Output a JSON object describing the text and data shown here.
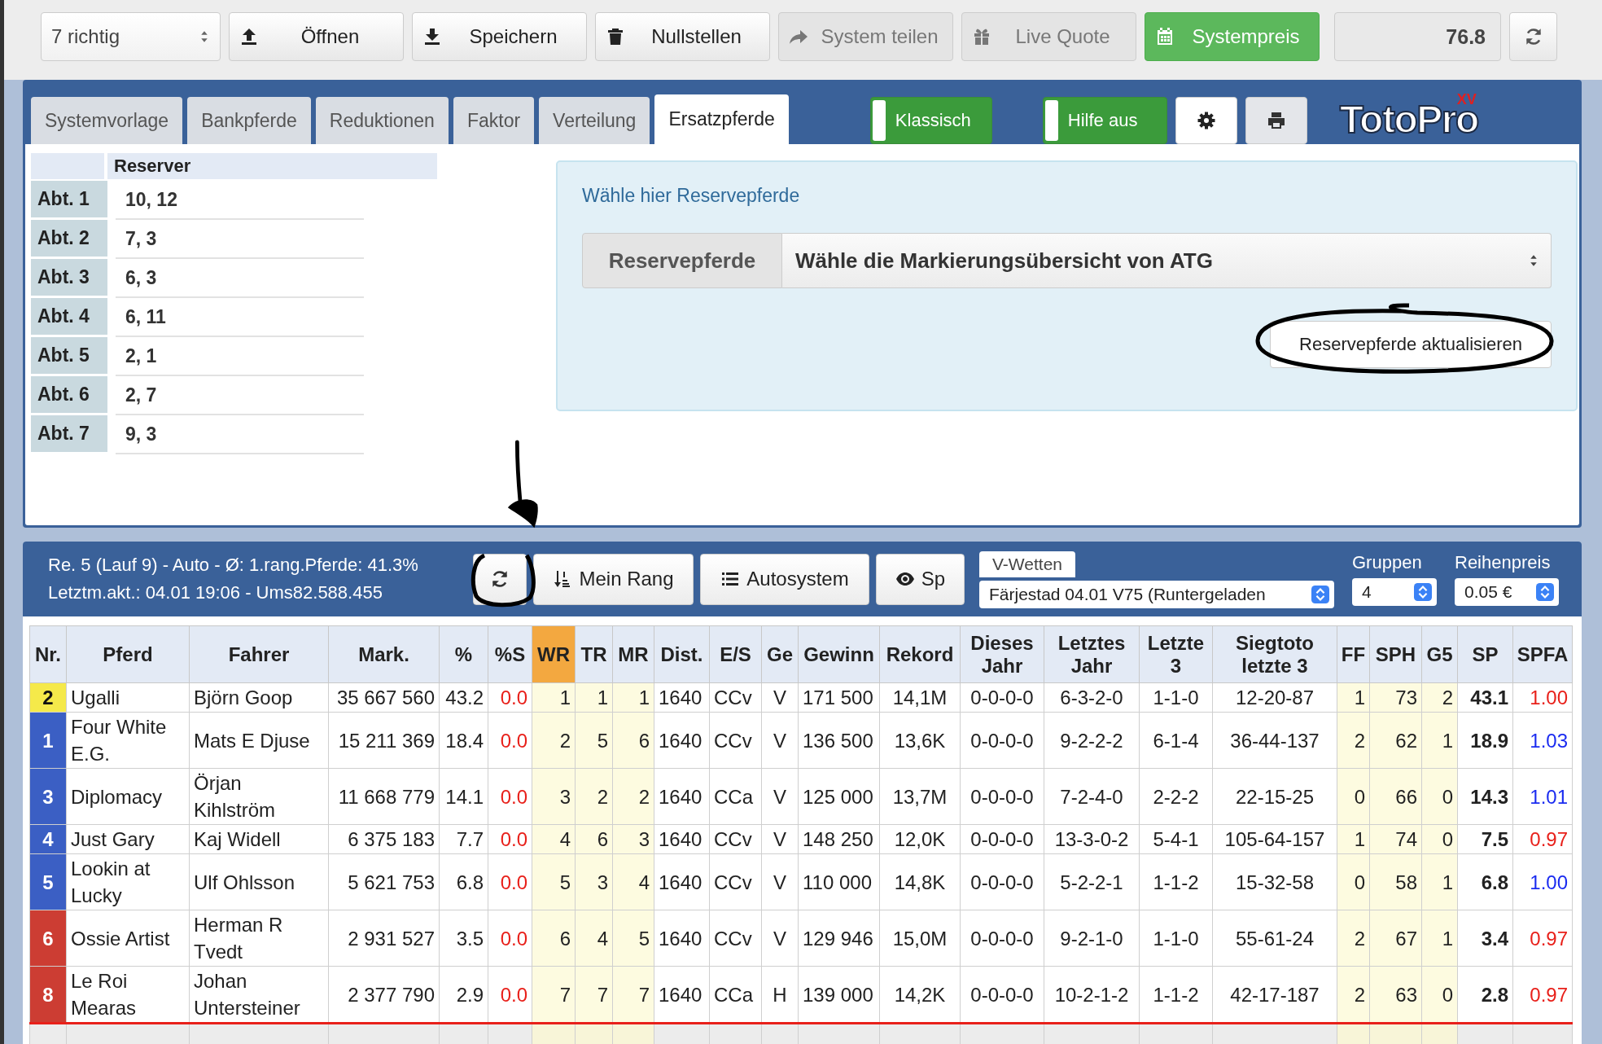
{
  "top_bar": {
    "select": {
      "value": "7 richtig"
    },
    "buttons": [
      {
        "label": "Öffnen",
        "kind": "default",
        "disabled": false
      },
      {
        "label": "Speichern",
        "kind": "default",
        "disabled": false
      },
      {
        "label": "Nullstellen",
        "kind": "default",
        "disabled": false
      },
      {
        "label": "System teilen",
        "kind": "default",
        "disabled": true
      },
      {
        "label": "Live Quote",
        "kind": "default",
        "disabled": true
      },
      {
        "label": "Systempreis",
        "kind": "success",
        "disabled": false
      }
    ],
    "price": {
      "value": "76.8"
    }
  },
  "tabs": [
    {
      "label": "Systemvorlage",
      "selected": false
    },
    {
      "label": "Bankpferde",
      "selected": false
    },
    {
      "label": "Reduktionen",
      "selected": false
    },
    {
      "label": "Faktor",
      "selected": false
    },
    {
      "label": "Verteilung",
      "selected": false
    },
    {
      "label": "Ersatzpferde",
      "selected": true
    }
  ],
  "toggles": [
    {
      "label": "Klassisch",
      "on": true
    },
    {
      "label": "Hilfe aus",
      "on": true
    }
  ],
  "logo": {
    "text": "TotoPro",
    "badge": "XV"
  },
  "reserve_table": {
    "heading": "Reserver",
    "rows": [
      {
        "label": "Abt. 1",
        "value": "10, 12"
      },
      {
        "label": "Abt. 2",
        "value": "7, 3"
      },
      {
        "label": "Abt. 3",
        "value": "6, 3"
      },
      {
        "label": "Abt. 4",
        "value": "6, 11"
      },
      {
        "label": "Abt. 5",
        "value": "2, 1"
      },
      {
        "label": "Abt. 6",
        "value": "2, 7"
      },
      {
        "label": "Abt. 7",
        "value": "9, 3"
      }
    ]
  },
  "reserve_panel": {
    "hint": "Wähle hier Reservepferde",
    "addon": "Reservepferde",
    "select": "Wähle die Markierungsübersicht von ATG",
    "button": "Reservepferde aktualisieren"
  },
  "race_bar": {
    "info": [
      "Re. 5 (Lauf 9) - Auto - Ø: 1.rang.Pferde: 41.3%",
      "Letztm.akt.: 04.01 19:06 - Ums82.588.455"
    ],
    "buttons": [
      "Mein Rang",
      "Autosystem",
      "Sp"
    ],
    "game_tab": "V-Wetten",
    "game_select": "Färjestad 04.01 V75 (Runtergeladen",
    "groups_label": "Gruppen",
    "groups": "4",
    "price_label": "Reihenpreis",
    "price": "0.05 €"
  },
  "table": {
    "columns": [
      {
        "label": "Nr.",
        "sorted": false,
        "marked": false
      },
      {
        "label": "Pferd",
        "sorted": false,
        "marked": false
      },
      {
        "label": "Fahrer",
        "sorted": false,
        "marked": false
      },
      {
        "label": "Mark.",
        "sorted": false,
        "marked": false
      },
      {
        "label": "%",
        "sorted": false,
        "marked": false
      },
      {
        "label": "%S",
        "sorted": false,
        "marked": false
      },
      {
        "label": "WR",
        "sorted": true,
        "marked": true
      },
      {
        "label": "TR",
        "sorted": false,
        "marked": true
      },
      {
        "label": "MR",
        "sorted": false,
        "marked": true
      },
      {
        "label": "Dist.",
        "sorted": false,
        "marked": false
      },
      {
        "label": "E/S",
        "sorted": false,
        "marked": false
      },
      {
        "label": "Ge",
        "sorted": false,
        "marked": false
      },
      {
        "label": "Gewinn",
        "sorted": false,
        "marked": false
      },
      {
        "label": "Rekord",
        "sorted": false,
        "marked": false
      },
      {
        "label": "Dieses Jahr",
        "sorted": false,
        "marked": false
      },
      {
        "label": "Letztes Jahr",
        "sorted": false,
        "marked": false
      },
      {
        "label": "Letzte 3",
        "sorted": false,
        "marked": false
      },
      {
        "label": "Siegtoto letzte 3",
        "sorted": false,
        "marked": false
      },
      {
        "label": "FF",
        "sorted": false,
        "marked": true
      },
      {
        "label": "SPH",
        "sorted": false,
        "marked": true
      },
      {
        "label": "G5",
        "sorted": false,
        "marked": true
      },
      {
        "label": "SP",
        "sorted": false,
        "marked": false
      },
      {
        "label": "SPFA",
        "sorted": false,
        "marked": false
      }
    ],
    "rows": [
      {
        "color": "#f5e94a",
        "cells": [
          "2",
          "Ugalli",
          "Björn Goop",
          "35 667 560",
          "43.2",
          "0.0",
          "1",
          "1",
          "1",
          "1640",
          "CCv",
          "V",
          "171 500",
          "14,1M",
          "0-0-0-0",
          "6-3-2-0",
          "1-1-0",
          "12-20-87",
          "1",
          "73",
          "2",
          "43.1"
        ],
        "spfa": {
          "value": "1.00",
          "color": "#e8201a"
        }
      },
      {
        "color": "#3b5fc4",
        "cells": [
          "1",
          "Four White E.G.",
          "Mats E Djuse",
          "15 211 369",
          "18.4",
          "0.0",
          "2",
          "5",
          "6",
          "1640",
          "CCv",
          "V",
          "136 500",
          "13,6K",
          "0-0-0-0",
          "9-2-2-2",
          "6-1-4",
          "36-44-137",
          "2",
          "62",
          "1",
          "18.9"
        ],
        "spfa": {
          "value": "1.03",
          "color": "#1a2bf0"
        }
      },
      {
        "color": "#3b5fc4",
        "cells": [
          "3",
          "Diplomacy",
          "Örjan Kihlström",
          "11 668 779",
          "14.1",
          "0.0",
          "3",
          "2",
          "2",
          "1640",
          "CCa",
          "V",
          "125 000",
          "13,7M",
          "0-0-0-0",
          "7-2-4-0",
          "2-2-2",
          "22-15-25",
          "0",
          "66",
          "0",
          "14.3"
        ],
        "spfa": {
          "value": "1.01",
          "color": "#1a2bf0"
        }
      },
      {
        "color": "#3b5fc4",
        "cells": [
          "4",
          "Just Gary",
          "Kaj Widell",
          "6 375 183",
          "7.7",
          "0.0",
          "4",
          "6",
          "3",
          "1640",
          "CCv",
          "V",
          "148 250",
          "12,0K",
          "0-0-0-0",
          "13-3-0-2",
          "5-4-1",
          "105-64-157",
          "1",
          "74",
          "0",
          "7.5"
        ],
        "spfa": {
          "value": "0.97",
          "color": "#e8201a"
        }
      },
      {
        "color": "#3b5fc4",
        "cells": [
          "5",
          "Lookin at Lucky",
          "Ulf Ohlsson",
          "5 621 753",
          "6.8",
          "0.0",
          "5",
          "3",
          "4",
          "1640",
          "CCv",
          "V",
          "110 000",
          "14,8K",
          "0-0-0-0",
          "5-2-2-1",
          "1-1-2",
          "15-32-58",
          "0",
          "58",
          "1",
          "6.8"
        ],
        "spfa": {
          "value": "1.00",
          "color": "#1a2bf0"
        }
      },
      {
        "color": "#cc3d33",
        "cells": [
          "6",
          "Ossie Artist",
          "Herman R Tvedt",
          "2 931 527",
          "3.5",
          "0.0",
          "6",
          "4",
          "5",
          "1640",
          "CCv",
          "V",
          "129 946",
          "15,0M",
          "0-0-0-0",
          "9-2-1-0",
          "1-1-0",
          "55-61-24",
          "2",
          "67",
          "1",
          "3.4"
        ],
        "spfa": {
          "value": "0.97",
          "color": "#e8201a"
        }
      },
      {
        "color": "#cc3d33",
        "cells": [
          "8",
          "Le Roi Mearas",
          "Johan Untersteiner",
          "2 377 790",
          "2.9",
          "0.0",
          "7",
          "7",
          "7",
          "1640",
          "CCa",
          "H",
          "139 000",
          "14,2K",
          "0-0-0-0",
          "10-2-1-2",
          "1-1-2",
          "42-17-187",
          "2",
          "63",
          "0",
          "2.8"
        ],
        "spfa": {
          "value": "0.97",
          "color": "#e8201a"
        }
      }
    ]
  }
}
